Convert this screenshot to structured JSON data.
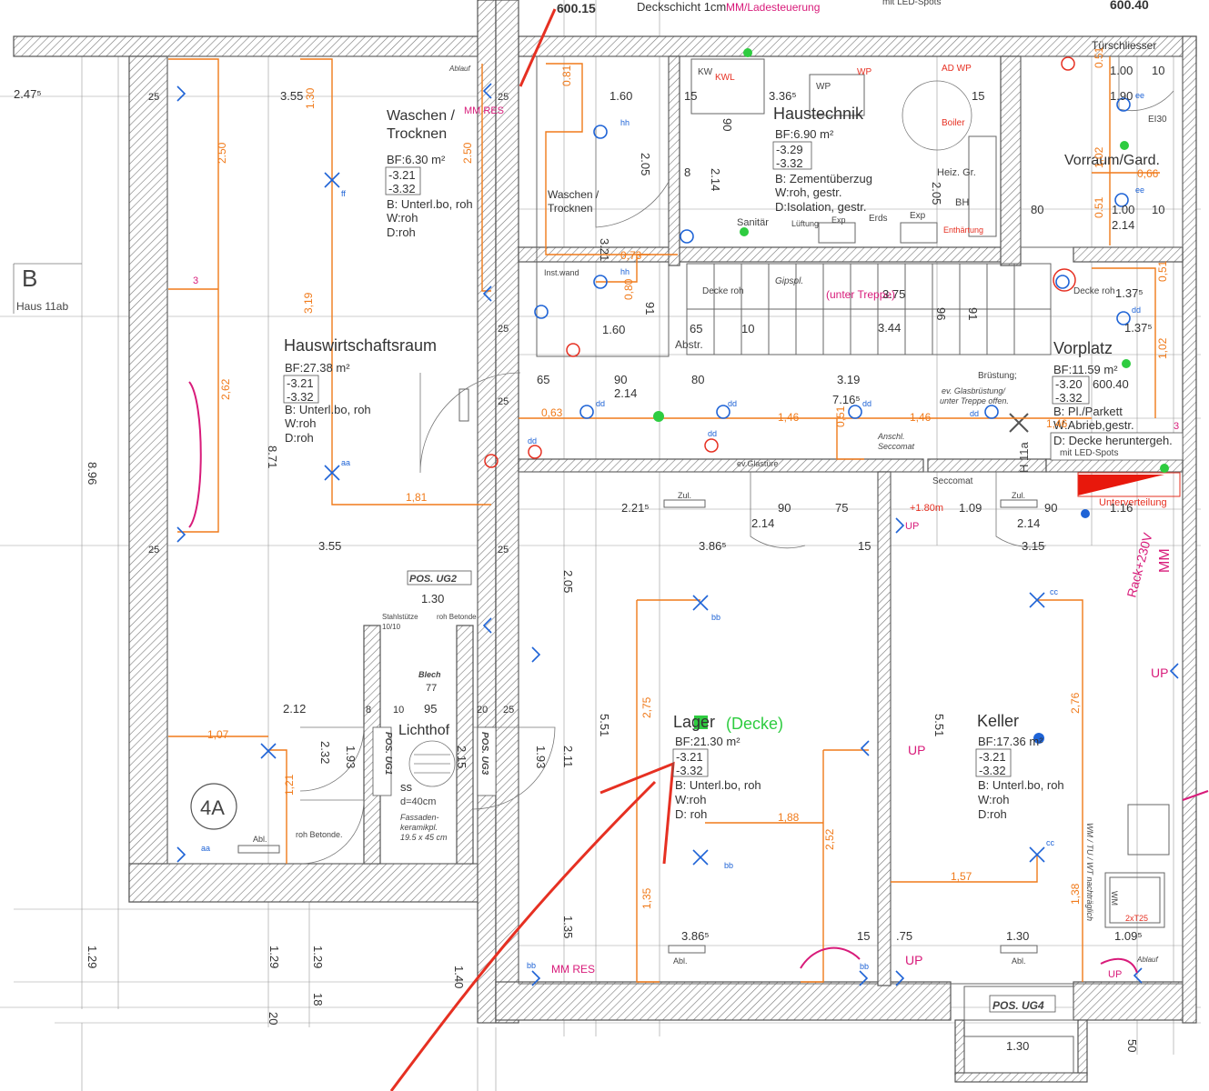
{
  "header": {
    "elev_left": "600.15",
    "deckschicht": "Deckschicht 1cm",
    "mm_note": "MM/Ladesteuerung",
    "elev_right": "600.40",
    "led_spots_top": "mit LED-Spots"
  },
  "axis": {
    "label": "B",
    "haus": "Haus 11ab",
    "elev_left": "2.47⁵"
  },
  "rooms": {
    "waschen_a": {
      "name1": "Waschen /",
      "name2": "Trocknen",
      "bf": "BF:6.30 m²",
      "lvl1": "-3.21",
      "lvl2": "-3.32",
      "b": "B: Unterl.bo, roh",
      "w": "W:roh",
      "d": "D:roh"
    },
    "haustechnik": {
      "name": "Haustechnik",
      "bf": "BF:6.90 m²",
      "lvl1": "-3.29",
      "lvl2": "-3.32",
      "b": "B: Zementüberzug",
      "w": "W:roh, gestr.",
      "d": "D:Isolation, gestr."
    },
    "waschen_b": {
      "name1": "Waschen /",
      "name2": "Trocknen"
    },
    "vorraum": {
      "name": "Vorraum/Gard."
    },
    "hauswirtschaft": {
      "name": "Hauswirtschaftsraum",
      "bf": "BF:27.38 m²",
      "lvl1": "-3.21",
      "lvl2": "-3.32",
      "b": "B: Unterl.bo, roh",
      "w": "W:roh",
      "d": "D:roh"
    },
    "vorplatz": {
      "name": "Vorplatz",
      "bf": "BF:11.59 m²",
      "lvl1": "-3.20",
      "lvl1b": "600.40",
      "lvl2": "-3.32",
      "b": "B: Pl./Parkett",
      "w": "W:Abrieb,gestr.",
      "d1": "D: Decke heruntergeh.",
      "d2": "mit LED-Spots"
    },
    "lager": {
      "name": "Lager",
      "note": "(Decke)",
      "bf": "BF:21.30 m²",
      "lvl1": "-3.21",
      "lvl2": "-3.32",
      "b": "B: Unterl.bo, roh",
      "w": "W:roh",
      "d": "D: roh"
    },
    "keller": {
      "name": "Keller",
      "bf": "BF:17.36 m²",
      "lvl1": "-3.21",
      "lvl2": "-3.32",
      "b": "B: Unterl.bo, roh",
      "w": "W:roh",
      "d": "D:roh"
    },
    "lichthof": {
      "name": "Lichthof",
      "ss": "ss",
      "d": "d=40cm",
      "fassade1": "Fassaden-",
      "fassade2": "keramikpl.",
      "fassade3": "19.5 x 45 cm"
    }
  },
  "labels": {
    "ablauf": "Ablauf",
    "tuerschliesser": "Türschliesser",
    "kw": "KW",
    "kwl": "KWL",
    "wp": "WP",
    "ad_wp": "AD WP",
    "boiler": "Boiler",
    "heiz": "Heiz. Gr.",
    "bh": "BH",
    "enthaertung": "Enthärtung",
    "sanitaer": "Sanitär",
    "lueftung": "Lüftung",
    "exp": "Exp",
    "erds": "Erds",
    "ei30": "EI30",
    "inst_wand": "Inst.wand",
    "decke_roh": "Decke roh",
    "gipspl": "Gipspl.",
    "unter_treppe": "(unter Treppe)",
    "abstr": "Abstr.",
    "bruestung": "Brüstung;",
    "glasbruestung": "ev. Glasbrüstung/",
    "treppe_offen": "unter Treppe offen.",
    "anschl": "Anschl.",
    "seccomat": "Seccomat",
    "ev_glastuere": "ev.Glastüre",
    "zul": "Zul.",
    "unterverteilung": "Unterverteilung",
    "rack": "Rack+230V",
    "mm": "MM",
    "mm_res": "MM RES",
    "h11a": "H 11a",
    "pos_ug2": "POS. UG2",
    "pos_ug1": "POS. UG1",
    "pos_ug3": "POS. UG3",
    "pos_ug4": "POS. UG4",
    "stahlstuetze": "Stahlstütze",
    "stahl_dim": "10/10",
    "roh_betonde": "roh Betonde",
    "roh_betonde2": "roh Betonde.",
    "blech": "Blech",
    "axis_4a": "4A",
    "abl": "Abl.",
    "wm_tu": "WM / TU / WT nachträglich",
    "wm": "WM",
    "x2t25": "2xT25",
    "up": "UP",
    "plus180": "+1.80m",
    "h3": "3"
  },
  "dims": {
    "d_355a": "3.55",
    "d_160": "1.60",
    "d_15a": "15",
    "d_3365": "3.36⁵",
    "d_15b": "15",
    "d_100": "1.00",
    "d_10": "10",
    "d_190": "1.90",
    "d_130a": "1.30",
    "d_250": "2.50",
    "d_250b": "2.50",
    "d_081": "0.81",
    "d_205a": "2.05",
    "d_214a": "2.14",
    "d_90a": "90",
    "d_8": "8",
    "d_205b": "2.05",
    "d_066": "0,66",
    "d_102": "1,02",
    "d_080": "80",
    "d_214b": "2.14",
    "d_051a": "0.51",
    "d_051b": "0.51",
    "d_319": "3,19",
    "d_321": "3.21",
    "d_073": "0,73",
    "d_080b": "0,80",
    "d_375": "3.75",
    "d_344": "3.44",
    "d_1375": "1.37⁵",
    "d_1375b": "1.37⁵",
    "d_051c": "0,51",
    "d_160b": "1.60",
    "d_65": "65",
    "d_10b": "10",
    "d_91": "91",
    "d_96": "96",
    "d_65b": "65",
    "d_90b": "90",
    "d_80": "80",
    "d_319b": "3.19",
    "d_214c": "2.14",
    "d_7165": "7.16⁵",
    "d_146a": "1,46",
    "d_146b": "1,46",
    "d_146c": "1,46",
    "d_063": "0,63",
    "d_051d": "0,51",
    "d_262": "2,62",
    "d_871": "8.71",
    "d_896": "8.96",
    "d_181": "1,81",
    "d_2215": "2.21⁵",
    "d_90c": "90",
    "d_75": "75",
    "d_109": "1.09",
    "d_90d": "90",
    "d_214d": "2.14",
    "d_214e": "2.14",
    "d_116": "1.16",
    "d_355b": "3.55",
    "d_3865a": "3.86⁵",
    "d_15c": "15",
    "d_315": "3.15",
    "d_205c": "2.05",
    "d_130b": "1.30",
    "d_212": "2.12",
    "d_8b": "8",
    "d_10c": "10",
    "d_95": "95",
    "d_20": "20",
    "d_25": "25",
    "d_77": "77",
    "d_232": "2.32",
    "d_193a": "1.93",
    "d_215": "2.15",
    "d_193b": "1.93",
    "d_107": "1,07",
    "d_121": "1,21",
    "d_551a": "5.51",
    "d_551b": "5.51",
    "d_275": "2,75",
    "d_211": "2.11",
    "d_276": "2,76",
    "d_188": "1,88",
    "d_252": "2,52",
    "d_157": "1,57",
    "d_135a": "1,35",
    "d_135b": "1.35",
    "d_3865b": "3.86⁵",
    "d_15d": "15",
    "d_75b": ".75",
    "d_130c": "1.30",
    "d_138": "1,38",
    "d_1095": "1.09⁵",
    "d_129a": "1.29",
    "d_129b": "1.29",
    "d_129c": "1.29",
    "d_140": "1.40",
    "d_18": "18",
    "d_20b": "20",
    "d_130d": "1.30",
    "d_50": "50",
    "d_600_15": "600.15"
  },
  "tags": [
    "ff",
    "aa",
    "hh",
    "ee",
    "dd",
    "bb",
    "cc"
  ],
  "colors": {
    "dimension": "#f07a1a",
    "electrical": "#1e63d6",
    "annotation_red": "#e63022",
    "annotation_magenta": "#d81b7a",
    "annotation_green": "#2ecc40",
    "wall_line": "#555555"
  }
}
